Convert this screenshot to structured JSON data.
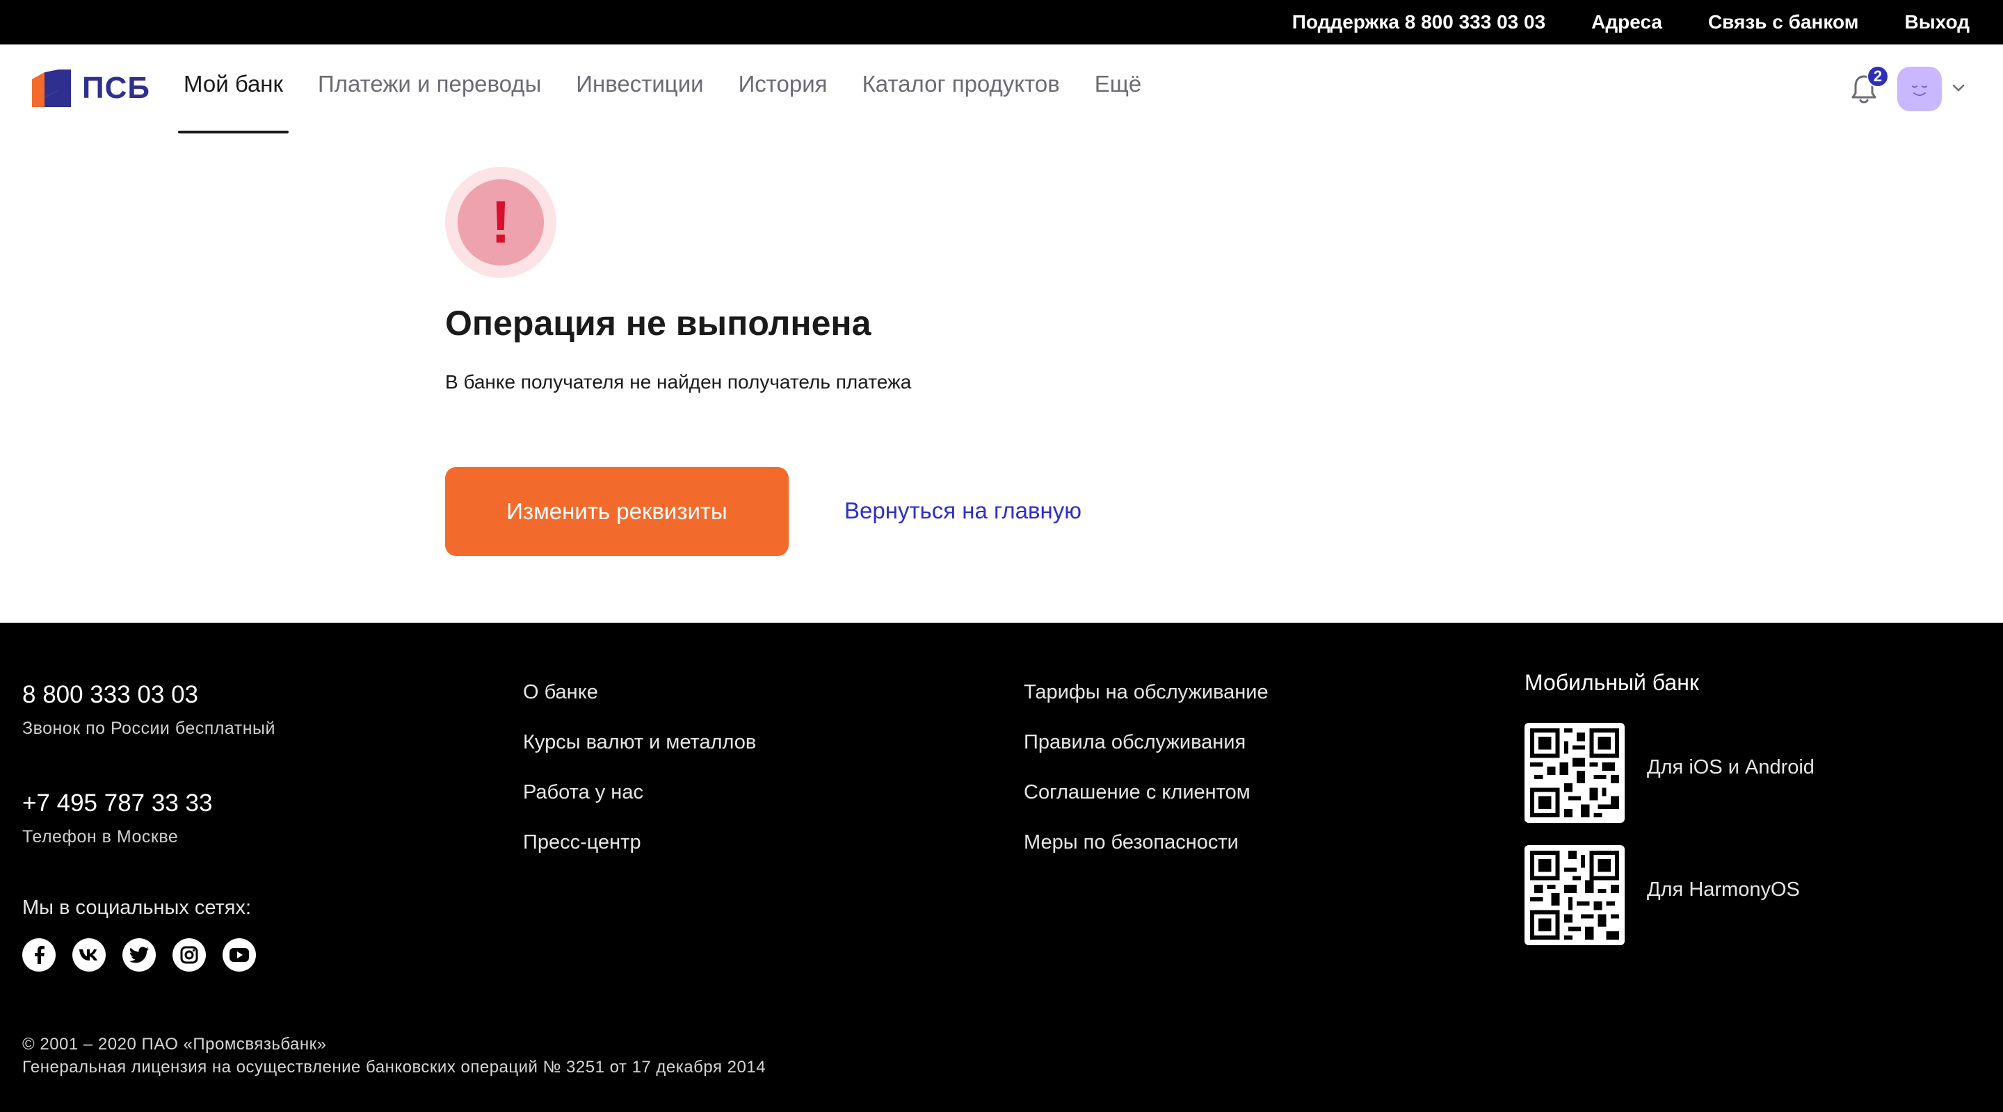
{
  "topbar": {
    "support": "Поддержка 8 800 333 03 03",
    "addresses": "Адреса",
    "contact_bank": "Связь с банком",
    "logout": "Выход"
  },
  "header": {
    "logo_text": "ПСБ",
    "nav": [
      {
        "label": "Мой банк",
        "active": true
      },
      {
        "label": "Платежи и переводы"
      },
      {
        "label": "Инвестиции"
      },
      {
        "label": "История"
      },
      {
        "label": "Каталог продуктов"
      },
      {
        "label": "Ещё"
      }
    ],
    "notifications_count": "2"
  },
  "error": {
    "icon_symbol": "!",
    "title": "Операция не выполнена",
    "description": "В банке получателя не найден получатель платежа",
    "primary_button": "Изменить реквизиты",
    "secondary_link": "Вернуться на главную"
  },
  "footer": {
    "phone1": "8 800 333 03 03",
    "phone1_sub": "Звонок по России бесплатный",
    "phone2": "+7 495 787 33 33",
    "phone2_sub": "Телефон в Москве",
    "social_title": "Мы в социальных сетях:",
    "socials": [
      "facebook-icon",
      "vk-icon",
      "twitter-icon",
      "instagram-icon",
      "youtube-icon"
    ],
    "col1": [
      "О банке",
      "Курсы валют и металлов",
      "Работа у нас",
      "Пресс-центр"
    ],
    "col2": [
      "Тарифы на обслуживание",
      "Правила обслуживания",
      "Соглашение с клиентом",
      "Меры по безопасности"
    ],
    "mobile_bank_title": "Мобильный банк",
    "qr1_label": "Для iOS и Android",
    "qr2_label": "Для HarmonyOS",
    "copyright1": "© 2001 – 2020 ПАО «Промсвязьбанк»",
    "copyright2": "Генеральная лицензия на осуществление банковских операций № 3251 от 17 декабря 2014"
  },
  "colors": {
    "brand_blue": "#2e2f8f",
    "accent_orange": "#f26b2d",
    "link_blue": "#2e2fc8",
    "error_red": "#d8102c"
  }
}
